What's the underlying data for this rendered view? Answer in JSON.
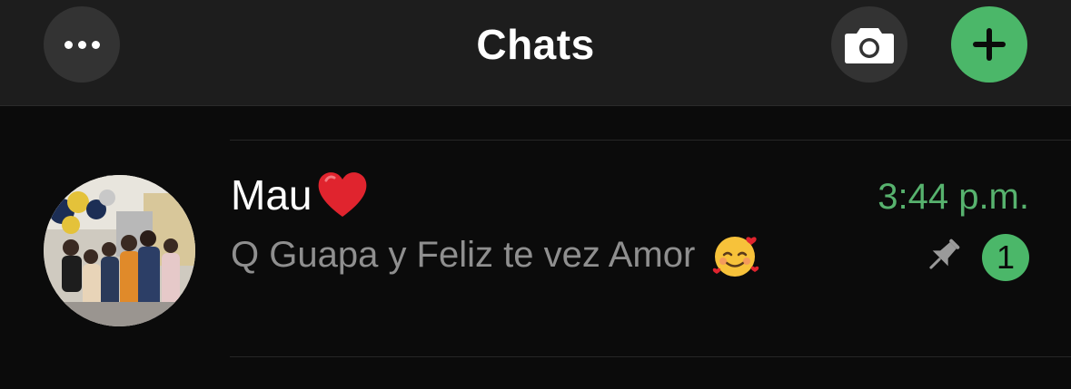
{
  "header": {
    "title": "Chats",
    "more_icon": "ellipsis-icon",
    "camera_icon": "camera-icon",
    "new_chat_icon": "plus-icon"
  },
  "colors": {
    "accent": "#4bb769",
    "time": "#57b26e",
    "preview": "#8f8f8f",
    "header_bg": "#1d1d1d",
    "page_bg": "#0b0b0b"
  },
  "chats": [
    {
      "name": "Mau",
      "name_emoji": "heart-emoji",
      "preview": "Q Guapa y Feliz te vez Amor",
      "preview_emoji": "smiling-face-with-hearts-emoji",
      "time": "3:44 p.m.",
      "pinned": true,
      "unread_count": "1"
    }
  ]
}
